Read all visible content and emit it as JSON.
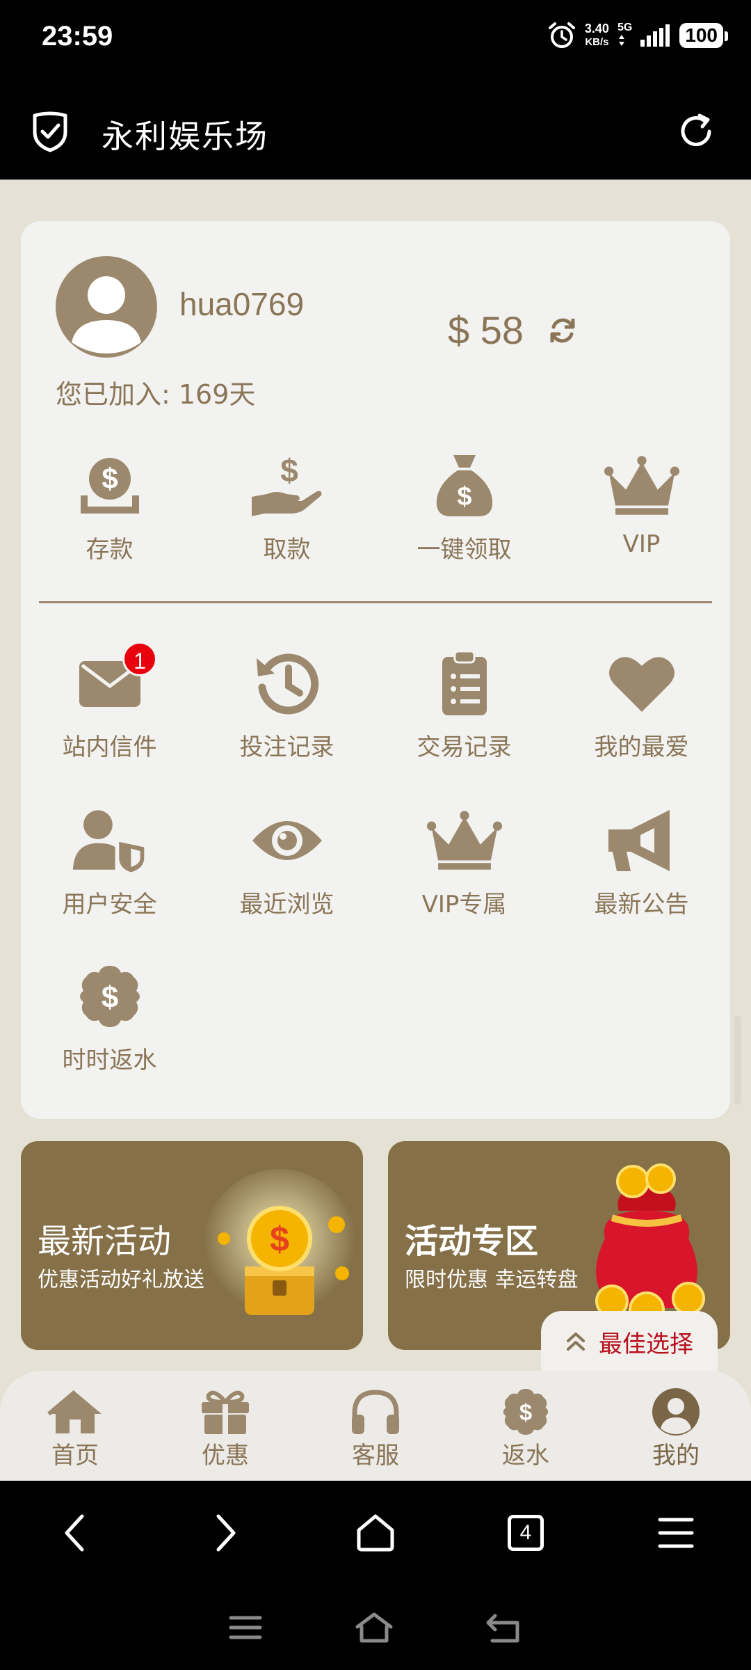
{
  "status_bar": {
    "time": "23:59",
    "speed_value": "3.40",
    "speed_unit": "KB/s",
    "network": "5G",
    "battery": "100"
  },
  "title_bar": {
    "title": "永利娱乐场",
    "shield_icon": "shield-check-icon",
    "refresh_icon": "refresh-icon"
  },
  "profile": {
    "username": "hua0769",
    "balance": "$ 58",
    "joined": "您已加入: 169天"
  },
  "quick_actions": [
    {
      "label": "存款",
      "icon": "deposit-icon"
    },
    {
      "label": "取款",
      "icon": "withdraw-icon"
    },
    {
      "label": "一键领取",
      "icon": "money-bag-icon"
    },
    {
      "label": "VIP",
      "icon": "crown-icon"
    }
  ],
  "menu_row1": [
    {
      "label": "站内信件",
      "icon": "mail-icon",
      "badge": "1"
    },
    {
      "label": "投注记录",
      "icon": "history-icon"
    },
    {
      "label": "交易记录",
      "icon": "clipboard-list-icon"
    },
    {
      "label": "我的最爱",
      "icon": "heart-icon"
    }
  ],
  "menu_row2": [
    {
      "label": "用户安全",
      "icon": "user-shield-icon"
    },
    {
      "label": "最近浏览",
      "icon": "eye-icon"
    },
    {
      "label": "VIP专属",
      "icon": "crown-icon"
    },
    {
      "label": "最新公告",
      "icon": "megaphone-icon"
    }
  ],
  "menu_row3": [
    {
      "label": "时时返水",
      "icon": "dollar-badge-icon"
    }
  ],
  "banners": [
    {
      "title": "最新活动",
      "subtitle": "优惠活动好礼放送"
    },
    {
      "title": "活动专区",
      "subtitle": "限时优惠 幸运转盘"
    }
  ],
  "best_choice": {
    "label": "最佳选择"
  },
  "tabs": [
    {
      "label": "首页",
      "icon": "home-icon"
    },
    {
      "label": "优惠",
      "icon": "gift-icon"
    },
    {
      "label": "客服",
      "icon": "headphones-icon"
    },
    {
      "label": "返水",
      "icon": "dollar-badge-icon"
    },
    {
      "label": "我的",
      "icon": "user-circle-icon",
      "active": true
    }
  ],
  "browser_nav": {
    "tab_count": "4"
  },
  "colors": {
    "accent": "#8a7556",
    "icon": "#9b886d",
    "banner": "#857048",
    "badge": "#e8000d",
    "best_choice_text": "#b80f1e"
  }
}
